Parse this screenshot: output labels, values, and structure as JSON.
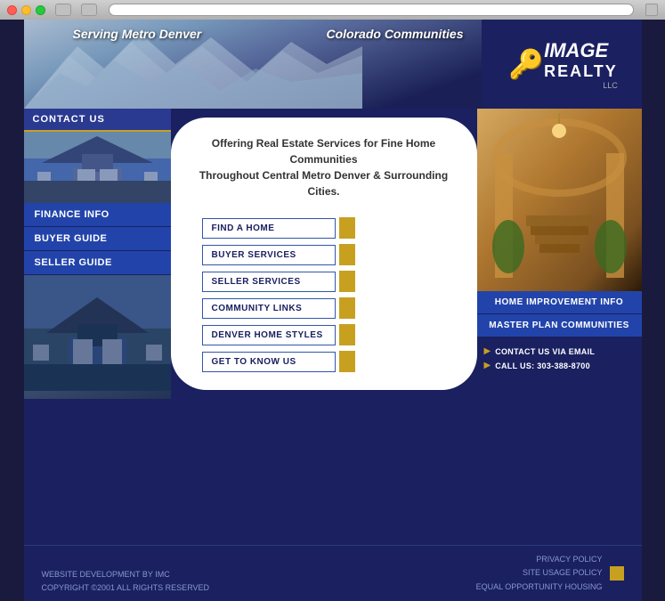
{
  "window": {
    "dots": [
      "red",
      "yellow",
      "green"
    ]
  },
  "header": {
    "text_left": "Serving Metro Denver",
    "text_right": "Colorado Communities",
    "logo": {
      "image": "IMAGE",
      "realty": "REALTY",
      "llc": "LLC"
    }
  },
  "sidebar": {
    "contact_header": "CONTACT US",
    "nav_items": [
      {
        "label": "FINANCE INFO"
      },
      {
        "label": "BUYER GUIDE"
      },
      {
        "label": "SELLER GUIDE"
      }
    ]
  },
  "main": {
    "intro_line1": "Offering Real Estate Services for Fine Home Communities",
    "intro_line2": "Throughout Central Metro Denver & Surrounding Cities.",
    "menu_items": [
      {
        "label": "FIND A HOME"
      },
      {
        "label": "BUYER SERVICES"
      },
      {
        "label": "SELLER SERVICES"
      },
      {
        "label": "COMMUNITY LINKS"
      },
      {
        "label": "DENVER HOME STYLES"
      },
      {
        "label": "GET TO KNOW US"
      }
    ]
  },
  "right_panel": {
    "nav_items": [
      {
        "label": "HOME IMPROVEMENT INFO"
      },
      {
        "label": "MASTER PLAN COMMUNITIES"
      }
    ],
    "contact": {
      "email_label": "CONTACT US VIA EMAIL",
      "phone_label": "CALL US: 303-388-8700"
    }
  },
  "footer": {
    "dev_text": "WEBSITE DEVELOPMENT BY IMC",
    "copyright": "COPYRIGHT ©2001 ALL RIGHTS RESERVED",
    "privacy": "PRIVACY POLICY",
    "site_usage": "SITE USAGE POLICY",
    "equal_opp": "EQUAL OPPORTUNITY HOUSING"
  }
}
